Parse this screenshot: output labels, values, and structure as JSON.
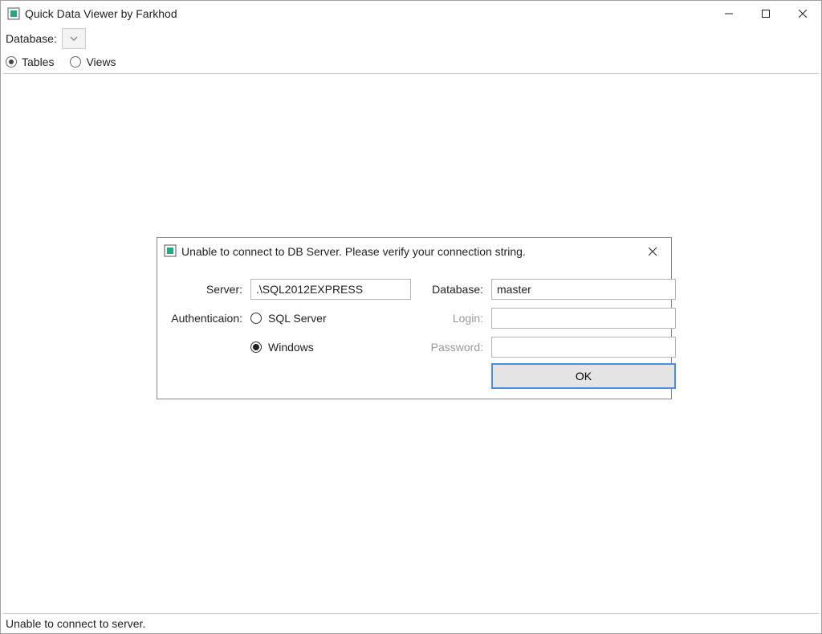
{
  "window": {
    "title": "Quick Data Viewer by Farkhod"
  },
  "toolbar": {
    "database_label": "Database:",
    "database_selected": ""
  },
  "object_type": {
    "tables_label": "Tables",
    "views_label": "Views",
    "selected": "tables"
  },
  "dialog": {
    "title": "Unable to connect to DB Server. Please verify your connection string.",
    "server_label": "Server:",
    "server_value": ".\\SQL2012EXPRESS",
    "database_label": "Database:",
    "database_value": "master",
    "auth_label": "Authenticaion:",
    "auth_sql_label": "SQL Server",
    "auth_win_label": "Windows",
    "auth_selected": "windows",
    "login_label": "Login:",
    "login_value": "",
    "password_label": "Password:",
    "password_value": "",
    "ok_label": "OK"
  },
  "status": {
    "text": "Unable to connect to server."
  }
}
